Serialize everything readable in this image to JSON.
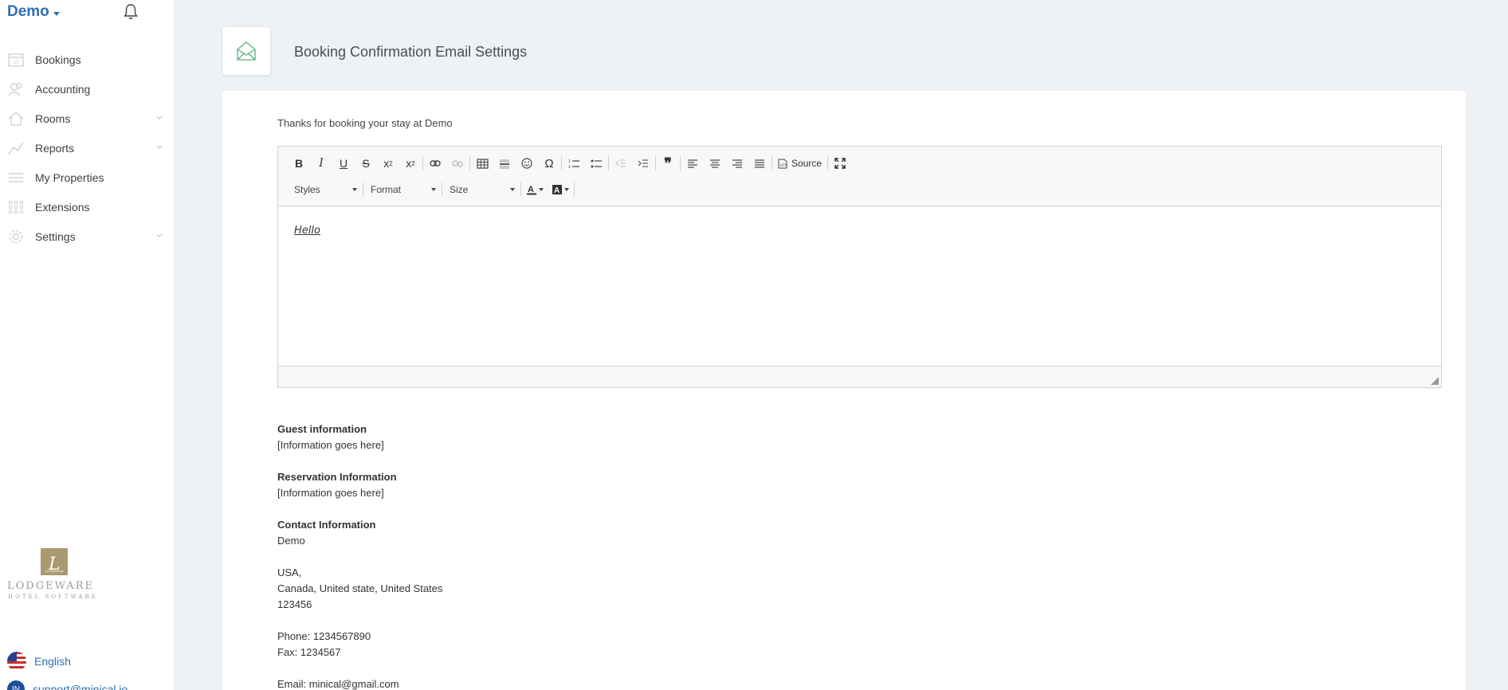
{
  "sidebar": {
    "brand": "Demo",
    "items": [
      {
        "label": "Bookings",
        "icon": "calendar-icon"
      },
      {
        "label": "Accounting",
        "icon": "users-icon"
      },
      {
        "label": "Rooms",
        "icon": "home-icon"
      },
      {
        "label": "Reports",
        "icon": "chart-line-icon"
      },
      {
        "label": "My Properties",
        "icon": "list-icon"
      },
      {
        "label": "Extensions",
        "icon": "grid-icon"
      },
      {
        "label": "Settings",
        "icon": "gear-icon"
      }
    ],
    "logo_text": "LODGEWARE",
    "logo_subtext": "HOTEL SOFTWARE",
    "language": "English",
    "support_initials": "IN",
    "support_email": "support@minical.io"
  },
  "header": {
    "title": "Booking Confirmation Email Settings"
  },
  "main": {
    "intro": "Thanks for booking your stay at Demo",
    "editor": {
      "source_label": "Source",
      "styles_label": "Styles",
      "format_label": "Format",
      "size_label": "Size",
      "content": "Hello"
    },
    "guest_heading": "Guest information",
    "guest_text": "[Information goes here]",
    "reservation_heading": "Reservation Information",
    "reservation_text": "[Information goes here]",
    "contact_heading": "Contact Information",
    "contact_name": "Demo",
    "address_1": "USA,",
    "address_2": "Canada, United state, United States",
    "postal": "123456",
    "phone": "Phone: 1234567890",
    "fax": "Fax: 1234567",
    "email": "Email: minical@gmail.com"
  },
  "colors": {
    "accent": "#2f6fb3",
    "icon_green": "#5cb07a",
    "background": "#eef1f5"
  }
}
